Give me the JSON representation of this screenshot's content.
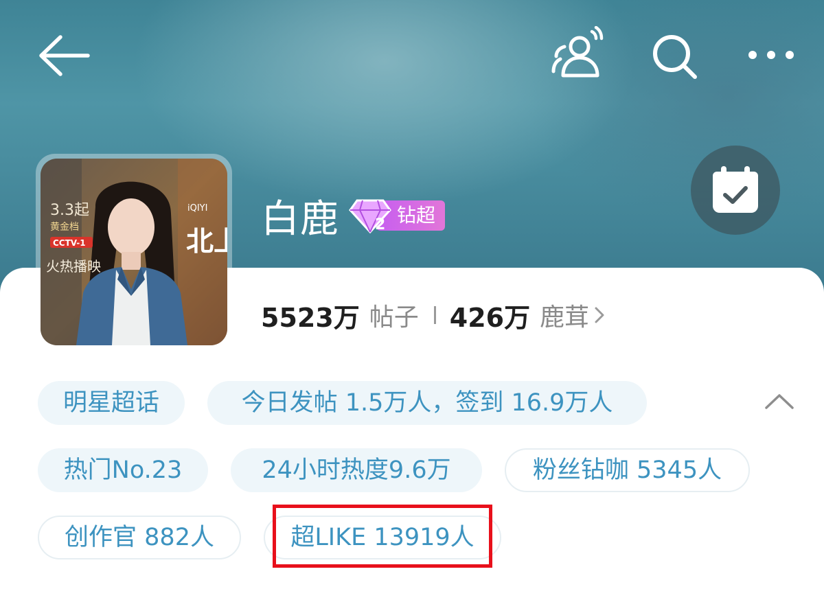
{
  "header": {
    "title": "白鹿",
    "badge_label": "钻超",
    "badge_level": "2",
    "icons": [
      "back-arrow-icon",
      "people-icon",
      "search-icon",
      "more-icon",
      "calendar-check-icon"
    ]
  },
  "stats": {
    "posts_count": "5523万",
    "posts_label": "帖子",
    "fans_count": "426万",
    "fans_label": "鹿茸"
  },
  "tags": {
    "row1": [
      "明星超话",
      "今日发帖 1.5万人，签到 16.9万人"
    ],
    "row2": [
      "热门No.23",
      "24小时热度9.6万",
      "粉丝钻咖 5345人"
    ],
    "row3": [
      "创作官 882人",
      "超LIKE 13919人"
    ]
  },
  "poster": {
    "date_text": "3.3起",
    "slot_text": "黄金档",
    "channel": "CCTV-1",
    "broadcast_text": "火热播映",
    "platform": "iQIYI",
    "show_title": "北上"
  },
  "colors": {
    "header_teal": "#4f95a6",
    "chip_text": "#3d93c0",
    "chip_bg": "#eef6fa",
    "badge_purple": "#c65ef0",
    "highlight_red": "#e8101b"
  }
}
